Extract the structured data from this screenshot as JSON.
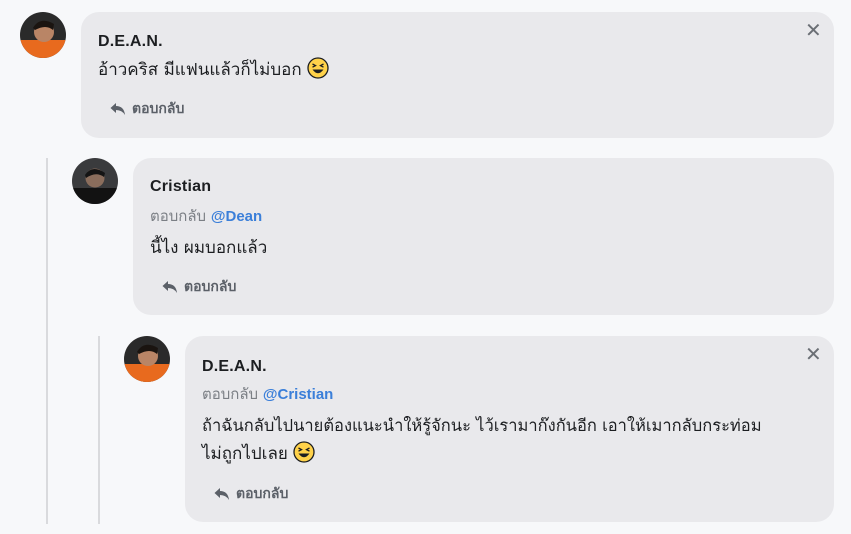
{
  "comments": [
    {
      "author": "D.E.A.N.",
      "reply_to_prefix": "",
      "reply_to_mention": "",
      "text": "อ้าวคริส มีแฟนแล้วก็ไม่บอก",
      "emoji": "laughing-emoji",
      "reply_label": "ตอบกลับ",
      "has_close": true,
      "avatar": "dean-avatar"
    },
    {
      "author": "Cristian",
      "reply_to_prefix": "ตอบกลับ",
      "reply_to_mention": "@Dean",
      "text": "นี้ไง ผมบอกแล้ว",
      "emoji": "",
      "reply_label": "ตอบกลับ",
      "has_close": false,
      "avatar": "cristian-avatar"
    },
    {
      "author": "D.E.A.N.",
      "reply_to_prefix": "ตอบกลับ",
      "reply_to_mention": "@Cristian",
      "text_line1": "ถ้าฉันกลับไปนายต้องแนะนำให้รู้จักนะ ไว้เรามาก๊งกันอีก เอาให้เมากลับกระท่อม",
      "text_line2": "ไม่ถูกไปเลย",
      "emoji": "laughing-emoji",
      "reply_label": "ตอบกลับ",
      "has_close": true,
      "avatar": "dean-avatar"
    }
  ],
  "colors": {
    "bubble": "#e9e9ec",
    "mention": "#3b7fd9",
    "background": "#f7f8fa"
  }
}
